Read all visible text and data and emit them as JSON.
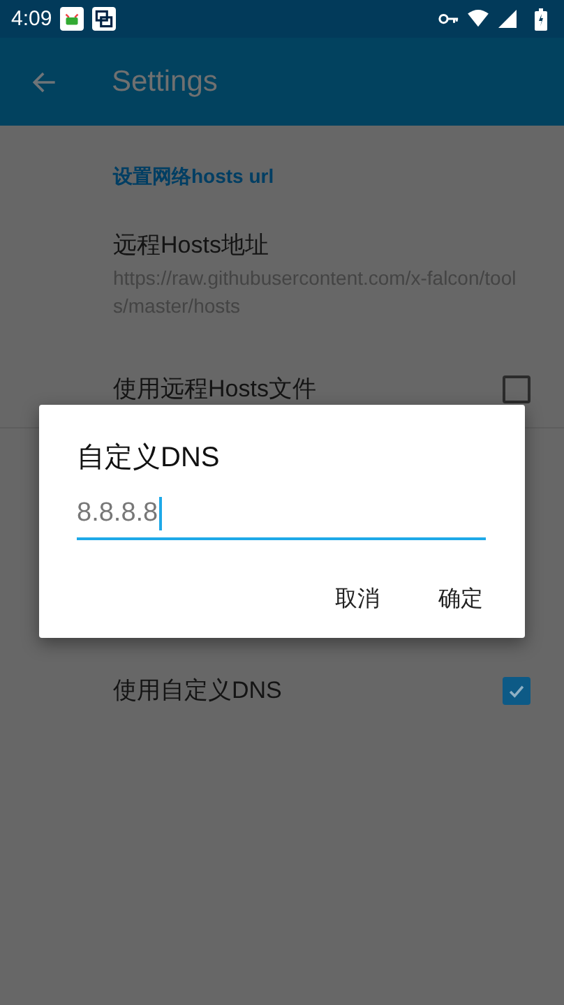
{
  "status_bar": {
    "time": "4:09"
  },
  "app_bar": {
    "title": "Settings"
  },
  "sections": [
    {
      "items": [
        {
          "kind": "category",
          "title": "设置网络hosts url"
        },
        {
          "kind": "text",
          "title": "远程Hosts地址",
          "summary": "https://raw.githubusercontent.com/x-falcon/tools/master/hosts"
        },
        {
          "kind": "checkbox",
          "title": "使用远程Hosts文件",
          "checked": false
        }
      ]
    },
    {
      "items": [
        {
          "kind": "checkbox",
          "title": "使用自定义DNS",
          "checked": true
        }
      ]
    }
  ],
  "dialog": {
    "title": "自定义DNS",
    "value": "8.8.8.8",
    "buttons": [
      "取消",
      "确定"
    ]
  }
}
